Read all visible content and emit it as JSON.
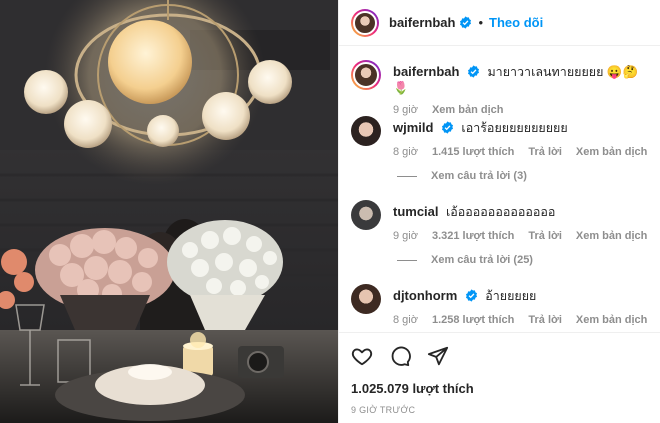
{
  "post": {
    "author": "baifernbah",
    "follow_label": "Theo dõi",
    "dot": "•",
    "caption": "มายาวาเลนทายยยยย 😛🤔🌷",
    "caption_time": "9 giờ",
    "caption_translate": "Xem bản dịch",
    "likes": "1.025.079 lượt thích",
    "timestamp": "9 GIỜ TRƯỚC"
  },
  "comments": [
    {
      "user": "wjmild",
      "verified": true,
      "text": "เอาร้อยยยยยยยยยย",
      "time": "8 giờ",
      "likes": "1.415 lượt thích",
      "reply": "Trả lời",
      "translate": "Xem bản dịch",
      "view_replies": "Xem câu trả lời (3)"
    },
    {
      "user": "tumcial",
      "verified": false,
      "text": "เอ้อออออออออออออ",
      "time": "9 giờ",
      "likes": "3.321 lượt thích",
      "reply": "Trả lời",
      "translate": "Xem bản dịch",
      "view_replies": "Xem câu trả lời (25)"
    },
    {
      "user": "djtonhorm",
      "verified": true,
      "text": "อ้ายยยยย",
      "time": "8 giờ",
      "likes": "1.258 lượt thích",
      "reply": "Trả lời",
      "translate": "Xem bản dịch"
    }
  ],
  "icons": {
    "like": "heart-icon",
    "comment": "comment-icon",
    "share": "share-icon",
    "verified": "verified-badge-icon"
  },
  "colors": {
    "accent": "#0095f6",
    "muted": "#8e8e8e",
    "text": "#262626"
  }
}
